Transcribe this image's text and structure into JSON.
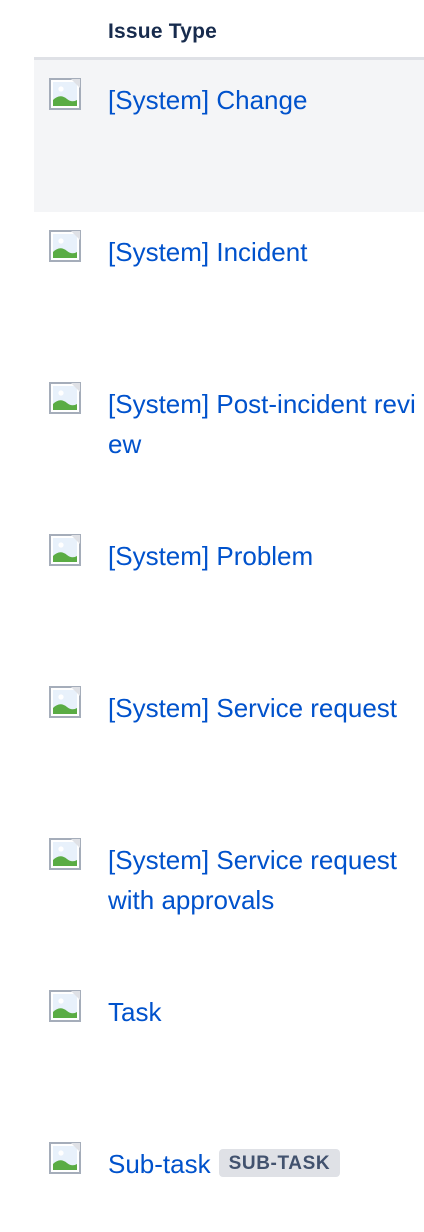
{
  "table": {
    "header": "Issue Type",
    "rows": [
      {
        "label": "[System] Change",
        "icon": "broken-image-icon",
        "selected": true
      },
      {
        "label": "[System] Incident",
        "icon": "broken-image-icon"
      },
      {
        "label": "[System] Post-incident review",
        "icon": "broken-image-icon"
      },
      {
        "label": "[System] Problem",
        "icon": "broken-image-icon"
      },
      {
        "label": "[System] Service request",
        "icon": "broken-image-icon"
      },
      {
        "label": "[System] Service request with approvals",
        "icon": "broken-image-icon"
      },
      {
        "label": "Task",
        "icon": "broken-image-icon"
      },
      {
        "label": "Sub-task",
        "icon": "broken-image-icon",
        "badge": "SUB-TASK"
      }
    ]
  },
  "colors": {
    "link": "#0052cc",
    "header_text": "#172b4d",
    "selected_row_bg": "#f4f5f7",
    "lozenge_bg": "#dfe1e6",
    "lozenge_text": "#42526e"
  }
}
